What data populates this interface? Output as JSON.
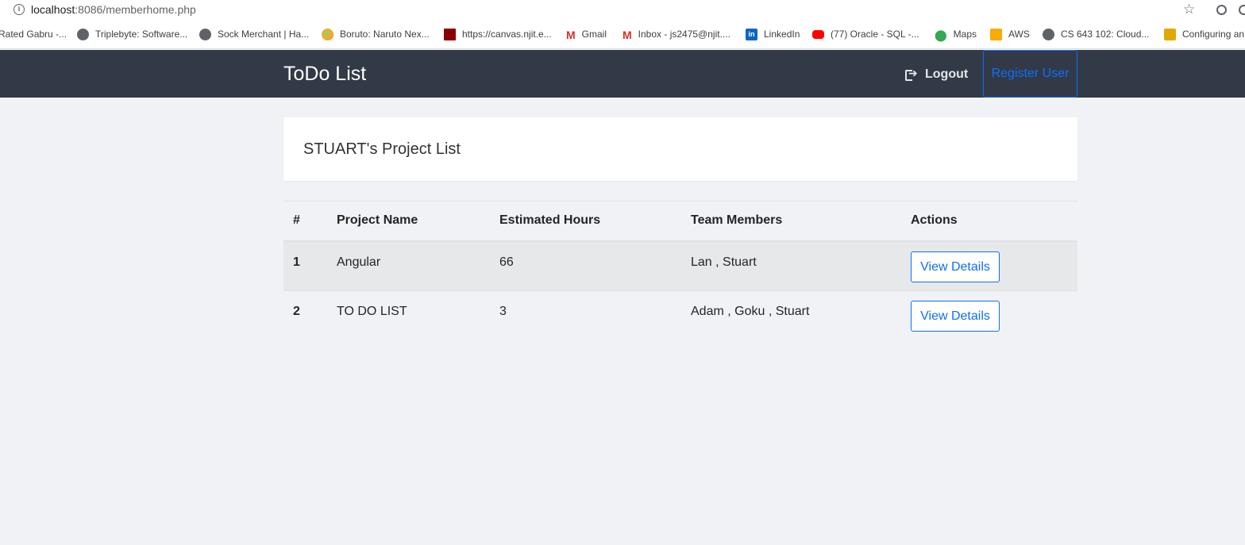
{
  "browser": {
    "url_host": "localhost",
    "url_rest": ":8086/memberhome.php",
    "bookmarks": [
      {
        "label": "Rated Gabru -...",
        "icon": "none"
      },
      {
        "label": "Triplebyte: Software...",
        "icon": "globe-icon"
      },
      {
        "label": "Sock Merchant | Ha...",
        "icon": "globe-icon"
      },
      {
        "label": "Boruto: Naruto Nex...",
        "icon": "naruto-icon"
      },
      {
        "label": "https://canvas.njit.e...",
        "icon": "njit-icon"
      },
      {
        "label": "Gmail",
        "icon": "gmail-icon"
      },
      {
        "label": "Inbox - js2475@njit....",
        "icon": "gmail-icon"
      },
      {
        "label": "LinkedIn",
        "icon": "linkedin-icon"
      },
      {
        "label": "(77) Oracle - SQL -...",
        "icon": "youtube-icon"
      },
      {
        "label": "Maps",
        "icon": "maps-icon"
      },
      {
        "label": "AWS",
        "icon": "aws-icon"
      },
      {
        "label": "CS 643 102: Cloud...",
        "icon": "globe-icon"
      },
      {
        "label": "Configuring an",
        "icon": "config-icon"
      }
    ]
  },
  "navbar": {
    "brand": "ToDo List",
    "logout_label": "Logout",
    "register_label": "Register User"
  },
  "card": {
    "title": "STUART's Project List"
  },
  "table": {
    "headers": [
      "#",
      "Project Name",
      "Estimated Hours",
      "Team Members",
      "Actions"
    ],
    "rows": [
      {
        "num": "1",
        "name": "Angular",
        "hours": "66",
        "members": "Lan , Stuart",
        "action": "View Details"
      },
      {
        "num": "2",
        "name": "TO DO LIST",
        "hours": "3",
        "members": "Adam , Goku , Stuart",
        "action": "View Details"
      }
    ]
  },
  "colors": {
    "navbar_bg": "#323a47",
    "page_bg": "#f1f2f6",
    "accent": "#0d6efd"
  }
}
